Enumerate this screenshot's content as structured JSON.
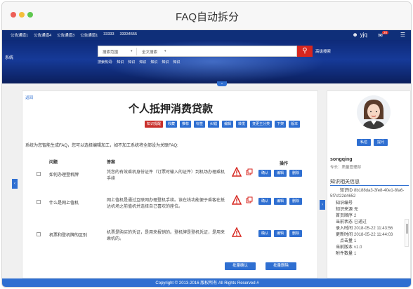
{
  "window": {
    "title": "FAQ自动拆分"
  },
  "topbar": {
    "nav": [
      "公告通道1",
      "公告通道4",
      "公告通道3",
      "公告通道1",
      "33333",
      "33334555"
    ],
    "user": "yjq",
    "badge": "20"
  },
  "banner": {
    "logo": "系统",
    "search": {
      "scope": "搜索范围",
      "scope2": "全文搜索",
      "advanced": "高级搜索"
    },
    "hot_label": "搜索热词:",
    "hot_words": [
      "知识",
      "知识",
      "知识",
      "知识",
      "知识",
      "知识"
    ]
  },
  "main": {
    "back": "返回",
    "title": "个人抵押消费贷款",
    "actions": [
      "知识提醒",
      "收藏",
      "推荐",
      "标签",
      "纠错",
      "编辑",
      "转发",
      "变更主分类",
      "下架",
      "版本"
    ],
    "hint": "系统为您智能生成FAQ，您可以选择编辑加工，如不加工系统将全部设为关联FAQ:",
    "headers": {
      "question": "问题",
      "answer": "答案",
      "ops": "操作"
    },
    "rows": [
      {
        "question": "如何办理登机牌",
        "answer": "凭您的有效乘机身份证件（订票时输入的证件）到机场办理乘机手续",
        "buttons": [
          "确认",
          "编辑",
          "删除"
        ]
      },
      {
        "question": "什么是网上值机",
        "answer": "网上值机是通过互联网办理登机手续。该在线功能便于乘客在抵达机场之前值机并选择自己喜欢的座位。",
        "buttons": [
          "确认",
          "编辑",
          "删除"
        ]
      },
      {
        "question": "机票和登机牌的区别",
        "answer": "机票是购买的凭证，是用来报销的。登机牌是登机凭证，是用来乘机的。",
        "buttons": [
          "确认",
          "编辑",
          "删除"
        ]
      }
    ],
    "batch": [
      "批量确认",
      "批量删除"
    ]
  },
  "side": {
    "profile_buttons": [
      "私信",
      "提问"
    ],
    "username": "songqing",
    "role": "专长：质量管理部",
    "section_title": "知识相关信息",
    "info": [
      {
        "k": "知识ID",
        "v": "8b188da3-3fe8-40e1-8fa6-5f7cf22d4652"
      },
      {
        "k": "知识编号",
        "v": ""
      },
      {
        "k": "知识来源",
        "v": "无"
      },
      {
        "k": "首页顺序",
        "v": "2"
      },
      {
        "k": "当前状态",
        "v": "已通过"
      },
      {
        "k": "录入时间",
        "v": "2018-05-22 11:43:56"
      },
      {
        "k": "更新时间",
        "v": "2018-05-22 11:44:03"
      },
      {
        "k": "点击量",
        "v": "1"
      },
      {
        "k": "当前版本",
        "v": "v1.0"
      },
      {
        "k": "附件数量",
        "v": "1"
      }
    ]
  },
  "footer": {
    "text": "Copyright © 2013-2016 版权所有 All Rights Reserved #"
  },
  "colors": {
    "brand": "#2f6fd1",
    "topbar": "#0f2f79",
    "alert": "#d7261f"
  }
}
